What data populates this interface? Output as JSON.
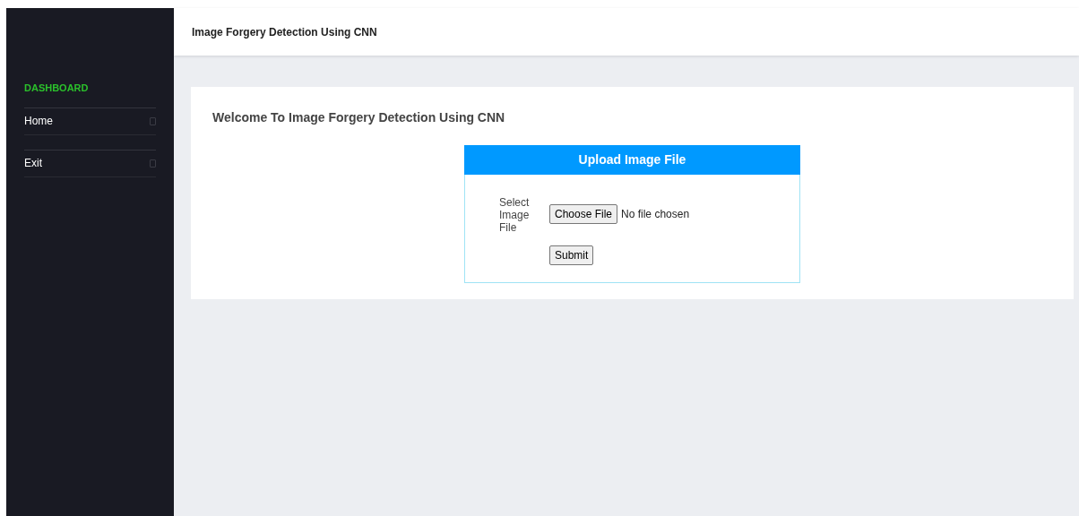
{
  "header": {
    "title": "Image Forgery Detection Using CNN"
  },
  "sidebar": {
    "heading": "DASHBOARD",
    "items": [
      {
        "label": "Home"
      },
      {
        "label": "Exit"
      }
    ]
  },
  "main": {
    "welcome": "Welcome To Image Forgery Detection Using CNN",
    "upload_panel": {
      "title": "Upload Image File",
      "field_label": "Select Image File",
      "choose_button": "Choose File",
      "file_status": "No file chosen",
      "submit_button": "Submit"
    }
  }
}
